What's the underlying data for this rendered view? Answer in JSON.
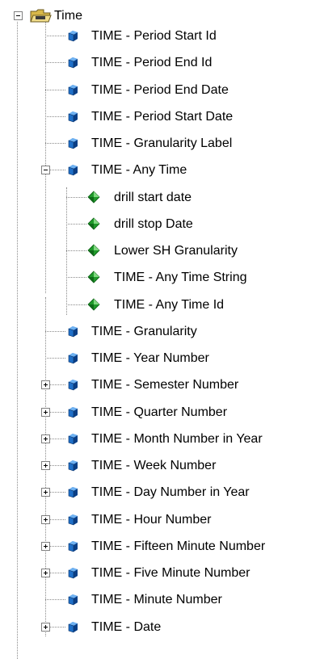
{
  "root": {
    "label": "Time",
    "icon": "folder-open-icon"
  },
  "items": [
    {
      "label": "TIME - Period Start Id",
      "icon": "cube-icon",
      "level": 1,
      "toggle": "none"
    },
    {
      "label": "TIME - Period End Id",
      "icon": "cube-icon",
      "level": 1,
      "toggle": "none"
    },
    {
      "label": "TIME - Period End Date",
      "icon": "cube-icon",
      "level": 1,
      "toggle": "none"
    },
    {
      "label": "TIME - Period Start Date",
      "icon": "cube-icon",
      "level": 1,
      "toggle": "none"
    },
    {
      "label": "TIME - Granularity Label",
      "icon": "cube-icon",
      "level": 1,
      "toggle": "none"
    },
    {
      "label": "TIME - Any Time",
      "icon": "cube-icon",
      "level": 1,
      "toggle": "minus"
    },
    {
      "label": "drill start date",
      "icon": "diamond-icon",
      "level": 2,
      "toggle": "none"
    },
    {
      "label": "drill stop Date",
      "icon": "diamond-icon",
      "level": 2,
      "toggle": "none"
    },
    {
      "label": "Lower SH Granularity",
      "icon": "diamond-icon",
      "level": 2,
      "toggle": "none"
    },
    {
      "label": "TIME - Any Time String",
      "icon": "diamond-icon",
      "level": 2,
      "toggle": "none"
    },
    {
      "label": "TIME - Any Time Id",
      "icon": "diamond-icon",
      "level": 2,
      "toggle": "none"
    },
    {
      "label": "TIME - Granularity",
      "icon": "cube-icon",
      "level": 1,
      "toggle": "none"
    },
    {
      "label": "TIME - Year Number",
      "icon": "cube-icon",
      "level": 1,
      "toggle": "none"
    },
    {
      "label": "TIME - Semester Number",
      "icon": "cube-icon",
      "level": 1,
      "toggle": "plus"
    },
    {
      "label": "TIME - Quarter Number",
      "icon": "cube-icon",
      "level": 1,
      "toggle": "plus"
    },
    {
      "label": "TIME - Month Number in Year",
      "icon": "cube-icon",
      "level": 1,
      "toggle": "plus"
    },
    {
      "label": "TIME - Week Number",
      "icon": "cube-icon",
      "level": 1,
      "toggle": "plus"
    },
    {
      "label": "TIME - Day Number in Year",
      "icon": "cube-icon",
      "level": 1,
      "toggle": "plus"
    },
    {
      "label": "TIME - Hour Number",
      "icon": "cube-icon",
      "level": 1,
      "toggle": "plus"
    },
    {
      "label": "TIME - Fifteen Minute Number",
      "icon": "cube-icon",
      "level": 1,
      "toggle": "plus"
    },
    {
      "label": "TIME - Five Minute Number",
      "icon": "cube-icon",
      "level": 1,
      "toggle": "plus"
    },
    {
      "label": "TIME - Minute Number",
      "icon": "cube-icon",
      "level": 1,
      "toggle": "none"
    },
    {
      "label": "TIME - Date",
      "icon": "cube-icon",
      "level": 1,
      "toggle": "plus"
    }
  ],
  "colors": {
    "cube_face": "#1f6fc8",
    "cube_dark": "#0b3f86",
    "diamond_green": "#1f9a2a",
    "folder": "#d8b84a"
  }
}
